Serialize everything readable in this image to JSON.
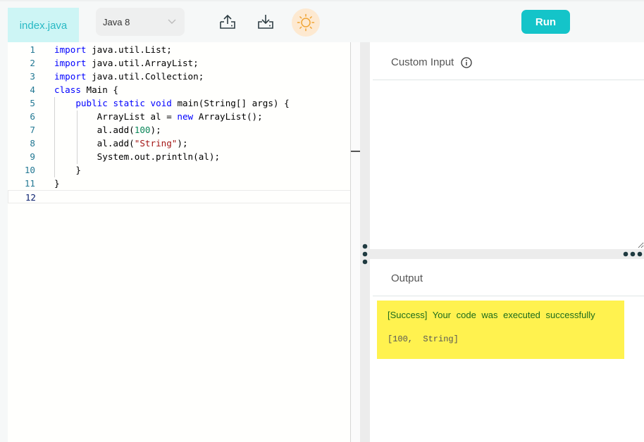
{
  "toolbar": {
    "file_tab": "index.java",
    "language": "Java 8",
    "upload_icon": "upload-icon",
    "download_icon": "download-icon",
    "theme_icon": "sun-icon",
    "run_label": "Run"
  },
  "editor": {
    "lines": [
      {
        "num": "1",
        "code": "import java.util.List;"
      },
      {
        "num": "2",
        "code": "import java.util.ArrayList;"
      },
      {
        "num": "3",
        "code": "import java.util.Collection;"
      },
      {
        "num": "4",
        "code": "class Main {"
      },
      {
        "num": "5",
        "code": "    public static void main(String[] args) {"
      },
      {
        "num": "6",
        "code": "        ArrayList al = new ArrayList();"
      },
      {
        "num": "7",
        "code": "        al.add(100);"
      },
      {
        "num": "8",
        "code": "        al.add(\"String\");"
      },
      {
        "num": "9",
        "code": "        System.out.println(al);"
      },
      {
        "num": "10",
        "code": "    }"
      },
      {
        "num": "11",
        "code": "}"
      },
      {
        "num": "12",
        "code": ""
      }
    ],
    "active_line": 12
  },
  "custom_input": {
    "title": "Custom Input",
    "info_icon": "info-icon",
    "value": ""
  },
  "output": {
    "title": "Output",
    "status": "[Success] Your code was executed successfully",
    "result": "[100,  String]",
    "highlight_color": "#fff24f"
  },
  "colors": {
    "accent": "#14c4c9",
    "file_tab_bg": "#cdf5f5",
    "keyword": "#0000ff",
    "number": "#098658",
    "string": "#a31515"
  }
}
